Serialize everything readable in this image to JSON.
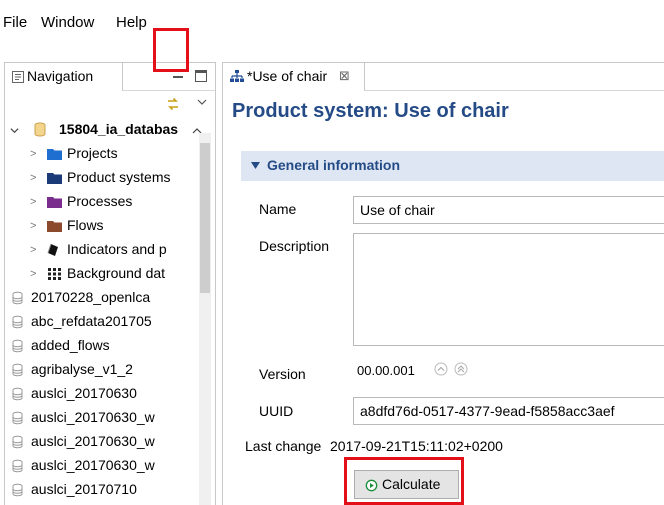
{
  "menu": {
    "file": "File",
    "window": "Window",
    "help": "Help"
  },
  "navigation": {
    "tab_label": "Navigation",
    "database": "15804_ia_databas",
    "folders": [
      {
        "label": "Projects",
        "color": "#1f6fd1"
      },
      {
        "label": "Product systems",
        "color": "#1b3a78"
      },
      {
        "label": "Processes",
        "color": "#7b2d8e"
      },
      {
        "label": "Flows",
        "color": "#8b4a2b"
      }
    ],
    "indicators": "Indicators and p",
    "background": "Background dat",
    "databases": [
      "20170228_openlca",
      "abc_refdata201705",
      "added_flows",
      "agribalyse_v1_2",
      "auslci_20170630",
      "auslci_20170630_w",
      "auslci_20170630_w",
      "auslci_20170630_w",
      "auslci_20170710"
    ]
  },
  "editor": {
    "tab_label": "*Use of chair",
    "title": "Product system: Use of chair",
    "section_title": "General information",
    "name_label": "Name",
    "name_value": "Use of chair",
    "description_label": "Description",
    "version_label": "Version",
    "version_value": "00.00.001",
    "uuid_label": "UUID",
    "uuid_value": "a8dfd76d-0517-4377-9ead-f5858acc3aef",
    "last_change_label": "Last change",
    "last_change_value": "2017-09-21T15:11:02+0200",
    "calculate_label": "Calculate"
  },
  "colors": {
    "highlight": "#e3101a",
    "title_blue": "#254b87",
    "section_bg": "#dde6f2",
    "run_green": "#1a8f3a"
  }
}
